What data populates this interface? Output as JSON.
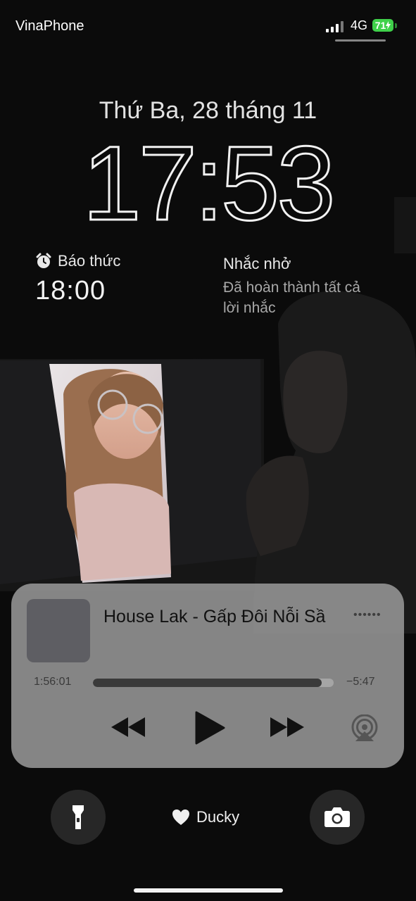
{
  "status_bar": {
    "carrier": "VinaPhone",
    "network": "4G",
    "battery": "71"
  },
  "lock_screen": {
    "date": "Thứ Ba, 28 tháng 11",
    "time": "17:53"
  },
  "widgets": {
    "alarm": {
      "label": "Báo thức",
      "time": "18:00",
      "icon": "alarm-clock-icon"
    },
    "reminders": {
      "title": "Nhắc nhở",
      "line1": "Đã hoàn thành tất cả",
      "line2": "lời nhắc"
    }
  },
  "now_playing": {
    "title": "House Lak - Gấp Đôi Nỗi Sầ",
    "elapsed": "1:56:01",
    "remaining": "−5:47",
    "progress": 0.95
  },
  "bottom": {
    "focus_label": "Ducky",
    "focus_icon": "heart-icon"
  },
  "colors": {
    "battery": "#3fd14a",
    "player_bg": "#969696",
    "background": "#0b0b0b"
  }
}
